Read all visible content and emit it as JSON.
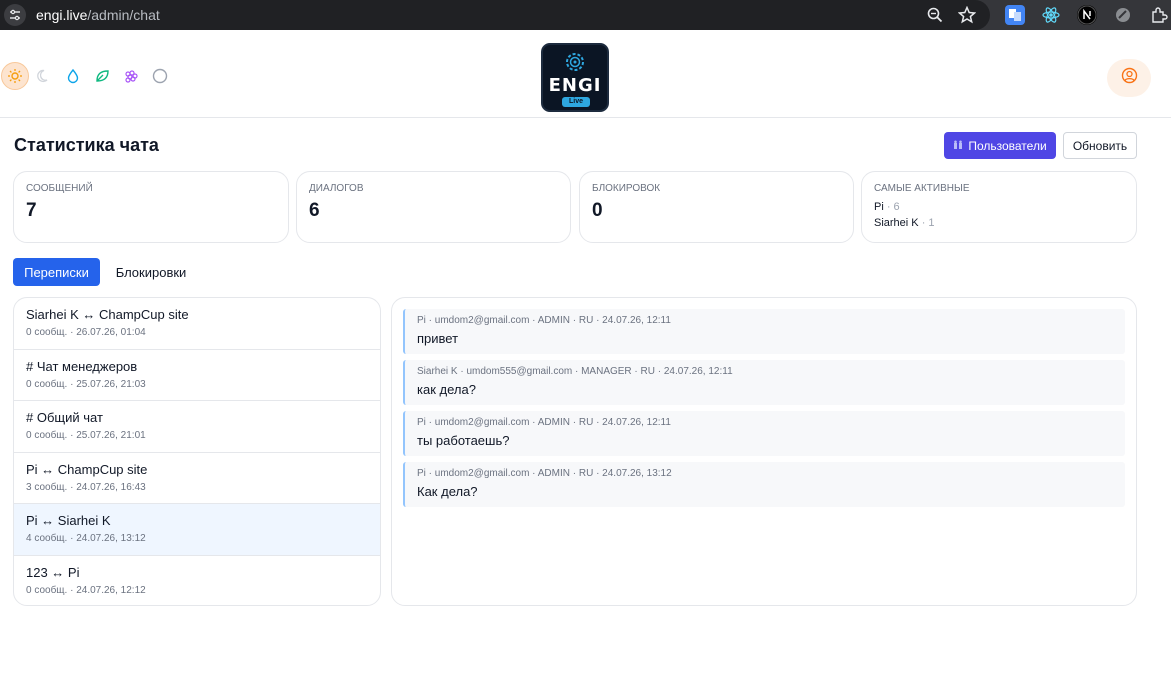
{
  "browser": {
    "url_host": "engi.live",
    "url_path": "/admin/chat"
  },
  "header": {
    "logo_text": "ENGI",
    "logo_tag": "Live"
  },
  "page": {
    "title": "Статистика чата",
    "users_button": "Пользователи",
    "refresh_button": "Обновить"
  },
  "stats": {
    "messages": {
      "label": "СООБЩЕНИЙ",
      "value": "7"
    },
    "dialogs": {
      "label": "ДИАЛОГОВ",
      "value": "6"
    },
    "blocks": {
      "label": "БЛОКИРОВОК",
      "value": "0"
    },
    "most_active": {
      "label": "САМЫЕ АКТИВНЫЕ",
      "users": [
        {
          "name": "Pi",
          "count": " · 6"
        },
        {
          "name": "Siarhei K",
          "count": " · 1"
        }
      ]
    }
  },
  "tabs": [
    {
      "label": "Переписки",
      "active": true
    },
    {
      "label": "Блокировки",
      "active": false
    }
  ],
  "conversations": [
    {
      "title": "Siarhei K ↔ ChampCup site",
      "meta": "0 сообщ. · 26.07.26, 01:04"
    },
    {
      "title": "# Чат менеджеров",
      "meta": "0 сообщ. · 25.07.26, 21:03"
    },
    {
      "title": "# Общий чат",
      "meta": "0 сообщ. · 25.07.26, 21:01"
    },
    {
      "title": "Pi ↔ ChampCup site",
      "meta": "3 сообщ. · 24.07.26, 16:43"
    },
    {
      "title": "Pi ↔ Siarhei K",
      "meta": "4 сообщ. · 24.07.26, 13:12"
    },
    {
      "title": "123 ↔ Pi",
      "meta": "0 сообщ. · 24.07.26, 12:12"
    }
  ],
  "messages": [
    {
      "meta": "Pi · umdom2@gmail.com · ADMIN · RU · 24.07.26, 12:11",
      "text": "привет"
    },
    {
      "meta": "Siarhei K · umdom555@gmail.com · MANAGER · RU · 24.07.26, 12:11",
      "text": "как дела?"
    },
    {
      "meta": "Pi · umdom2@gmail.com · ADMIN · RU · 24.07.26, 12:11",
      "text": "ты работаешь?"
    },
    {
      "meta": "Pi · umdom2@gmail.com · ADMIN · RU · 24.07.26, 13:12",
      "text": "Как дела?"
    }
  ],
  "colors": {
    "primary": "#2563eb",
    "indigo": "#4f46e5",
    "accent_orange": "#f59e0b"
  }
}
